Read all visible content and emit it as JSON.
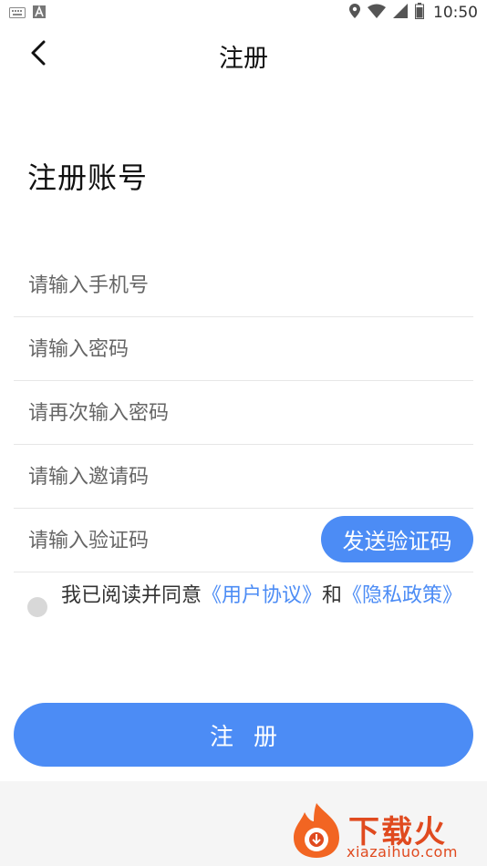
{
  "status_bar": {
    "time": "10:50",
    "icons": [
      "keyboard-icon",
      "text-a-icon",
      "location-icon",
      "wifi-icon",
      "signal-icon",
      "battery-icon"
    ]
  },
  "nav": {
    "title": "注册",
    "back_icon": "chevron-left-icon"
  },
  "page_title": "注册账号",
  "form": {
    "phone_placeholder": "请输入手机号",
    "password_placeholder": "请输入密码",
    "confirm_password_placeholder": "请再次输入密码",
    "invite_code_placeholder": "请输入邀请码",
    "verify_code_placeholder": "请输入验证码",
    "send_code_label": "发送验证码"
  },
  "agreement": {
    "prefix": "我已阅读并同意",
    "user_agreement": "《用户协议》",
    "conjunction": "和",
    "privacy_policy": "《隐私政策》"
  },
  "register_label": "注册",
  "watermark": {
    "title": "下载火",
    "url": "xiazaihuo.com"
  },
  "colors": {
    "accent": "#4c8cf5",
    "watermark": "#e04a1f"
  }
}
